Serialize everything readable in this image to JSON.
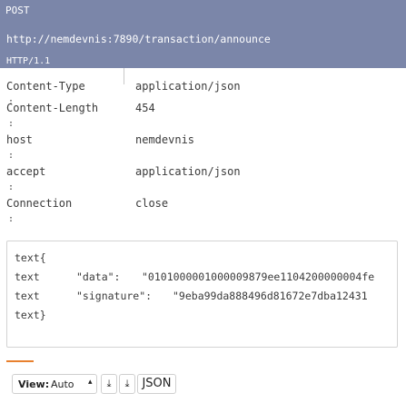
{
  "request": {
    "method": "POST",
    "url": "http://nemdevnis:7890/transaction/announce",
    "version": "HTTP/1.1"
  },
  "headers": [
    {
      "name": "Content-Type",
      "sep": ":",
      "value": "application/json"
    },
    {
      "name": "Content-Length",
      "sep": ":",
      "value": "454"
    },
    {
      "name": "host",
      "sep": ":",
      "value": "nemdevnis"
    },
    {
      "name": "accept",
      "sep": ":",
      "value": "application/json"
    },
    {
      "name": "Connection",
      "sep": ":",
      "value": "close"
    }
  ],
  "body": {
    "open": "text{",
    "line1_kw": "text",
    "line1_key": "\"data\":",
    "line1_val": "\"0101000001000009879ee1104200000004fe",
    "line2_kw": "text",
    "line2_key": "\"signature\":",
    "line2_val": "\"9eba99da888496d81672e7dba12431",
    "close": "text}"
  },
  "toolbar": {
    "view_label": "View:",
    "view_value": "Auto",
    "caret": "▴",
    "download_glyph": "⤓",
    "download2_glyph": "⤓",
    "json_label": "JSON"
  },
  "colors": {
    "header_bar": "#7b86a9",
    "accent": "#e8802e"
  }
}
